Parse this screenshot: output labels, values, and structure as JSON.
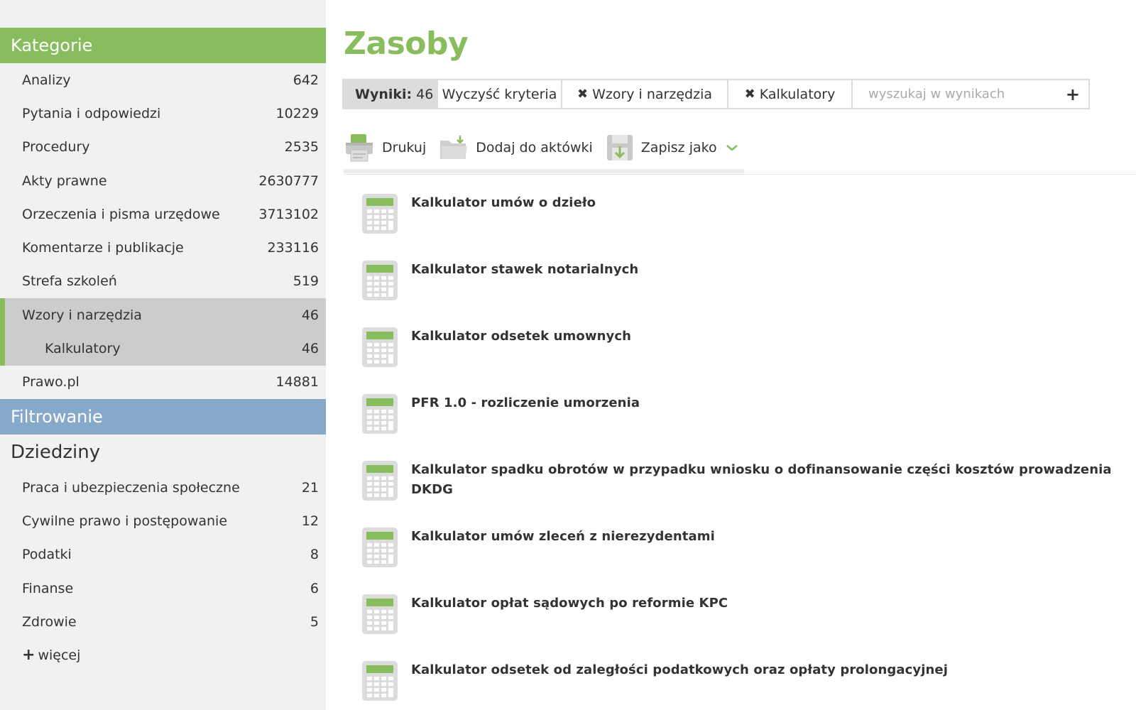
{
  "sidebar": {
    "categories_header": "Kategorie",
    "categories": [
      {
        "label": "Analizy",
        "count": "642"
      },
      {
        "label": "Pytania i odpowiedzi",
        "count": "10229"
      },
      {
        "label": "Procedury",
        "count": "2535"
      },
      {
        "label": "Akty prawne",
        "count": "2630777"
      },
      {
        "label": "Orzeczenia i pisma urzędowe",
        "count": "3713102"
      },
      {
        "label": "Komentarze i publikacje",
        "count": "233116"
      },
      {
        "label": "Strefa szkoleń",
        "count": "519"
      },
      {
        "label": "Wzory i narzędzia",
        "count": "46",
        "active": true
      },
      {
        "label": "Kalkulatory",
        "count": "46",
        "active": true,
        "sub": true
      },
      {
        "label": "Prawo.pl",
        "count": "14881"
      }
    ],
    "filter_header": "Filtrowanie",
    "domains_title": "Dziedziny",
    "domains": [
      {
        "label": "Praca i ubezpieczenia społeczne",
        "count": "21"
      },
      {
        "label": "Cywilne prawo i postępowanie",
        "count": "12"
      },
      {
        "label": "Podatki",
        "count": "8"
      },
      {
        "label": "Finanse",
        "count": "6"
      },
      {
        "label": "Zdrowie",
        "count": "5"
      }
    ],
    "more_label": "więcej"
  },
  "main": {
    "title": "Zasoby",
    "filterbar": {
      "results_label": "Wyniki:",
      "results_count": "46",
      "clear_label": "Wyczyść kryteria",
      "tag1": "Wzory i narzędzia",
      "tag2": "Kalkulatory",
      "search_placeholder": "wyszukaj w wynikach"
    },
    "toolbar": {
      "print": "Drukuj",
      "add_to_briefcase": "Dodaj do aktówki",
      "save_as": "Zapisz jako"
    },
    "results": [
      {
        "title": "Kalkulator umów o dzieło"
      },
      {
        "title": "Kalkulator stawek notarialnych"
      },
      {
        "title": "Kalkulator odsetek umownych"
      },
      {
        "title": "PFR 1.0 - rozliczenie umorzenia"
      },
      {
        "title": "Kalkulator spadku obrotów w przypadku wniosku o dofinansowanie części kosztów prowadzenia DKDG"
      },
      {
        "title": "Kalkulator umów zleceń z nierezydentami"
      },
      {
        "title": "Kalkulator opłat sądowych po reformie KPC"
      },
      {
        "title": "Kalkulator odsetek od zaległości podatkowych oraz opłaty prolongacyjnej"
      }
    ]
  },
  "colors": {
    "accent_green": "#88bd5d",
    "filter_blue": "#87a9c9",
    "sidebar_bg": "#f1f1f1",
    "active_bg": "#cccccc"
  }
}
